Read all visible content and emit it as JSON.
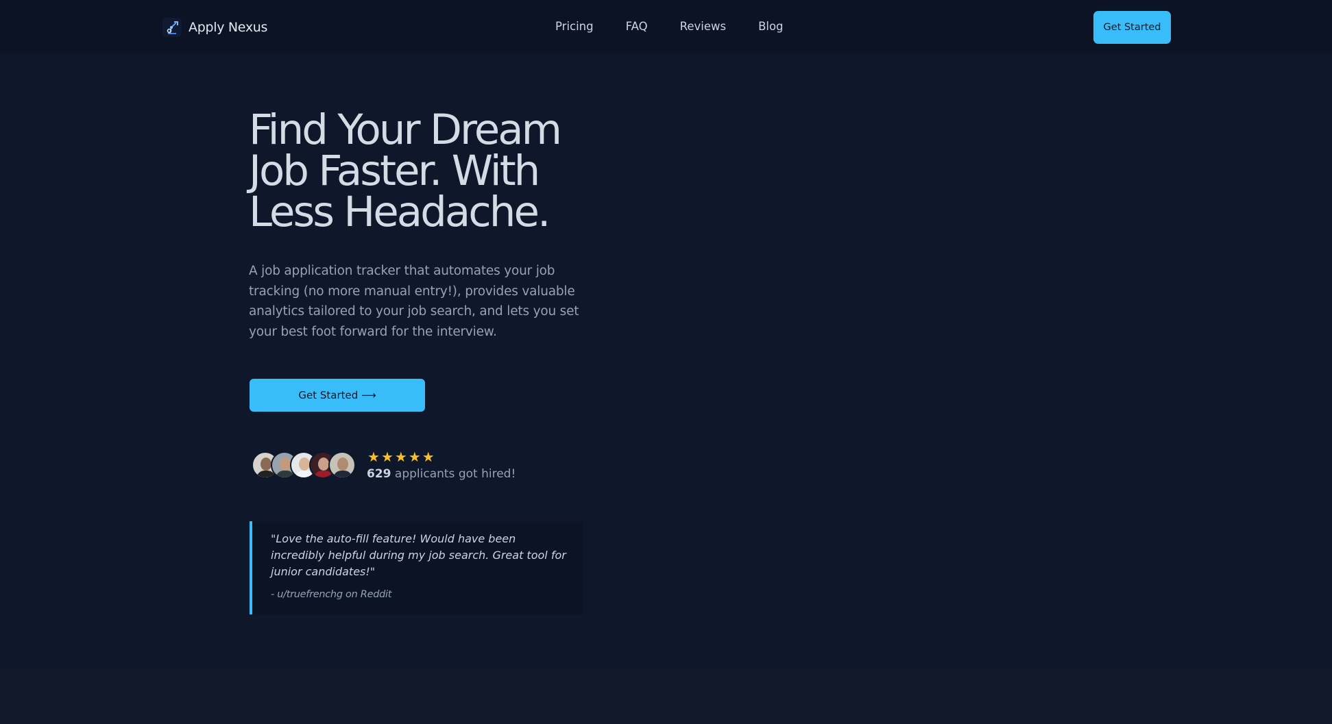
{
  "nav": {
    "brand": "Apply Nexus",
    "links": [
      "Pricing",
      "FAQ",
      "Reviews",
      "Blog"
    ],
    "cta": "Get Started"
  },
  "hero": {
    "headline": "Find Your Dream Job Faster. With Less Headache.",
    "subtext": "A job application tracker that automates your job tracking (no more manual entry!), provides valuable analytics tailored to your job search, and lets you set your best foot forward for the interview.",
    "cta": "Get Started ⟶"
  },
  "social_proof": {
    "rating_stars": 5,
    "hired_count": "629",
    "hired_text": " applicants got hired!",
    "avatar_count": 5
  },
  "testimonial": {
    "quote": "\"Love the auto-fill feature! Would have been incredibly helpful during my job search. Great tool for junior candidates!\"",
    "author": "- u/truefrenchg on Reddit"
  },
  "colors": {
    "background": "#0f172a",
    "nav_background": "#0c1324",
    "accent": "#38bdf8",
    "star": "#fbbf24"
  },
  "icons": {
    "brand_logo": "robot-arm-icon",
    "star": "star-icon",
    "arrow": "arrow-right-icon"
  }
}
